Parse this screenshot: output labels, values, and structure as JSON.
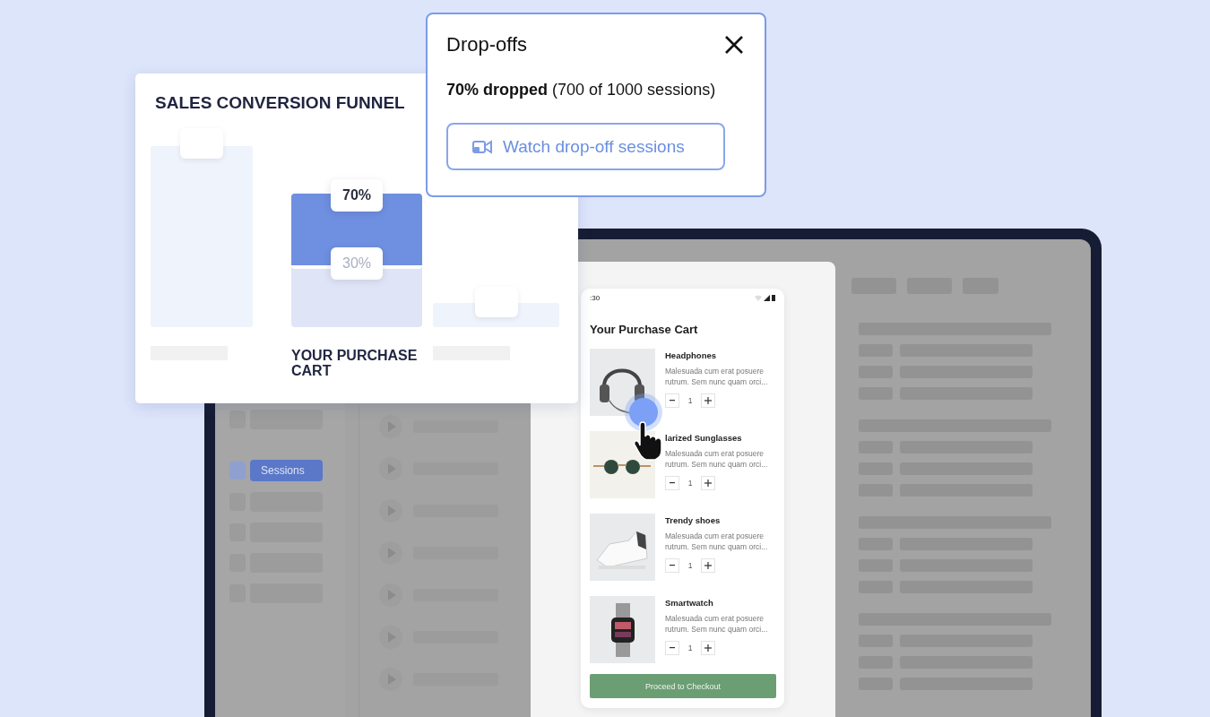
{
  "funnel": {
    "title": "SALES CONVERSION FUNNEL",
    "steps": [
      {
        "kind": "plain"
      },
      {
        "kind": "split",
        "top_badge": "70%",
        "bottom_badge": "30%",
        "label": "YOUR PURCHASE CART"
      },
      {
        "kind": "plain"
      }
    ]
  },
  "popup": {
    "title": "Drop-offs",
    "summary": "**70% dropped** (700 of 1000 sessions)",
    "button": "Watch drop-off sessions"
  },
  "sidebar": {
    "items": [
      {
        "label": "Sessions",
        "selected": true
      }
    ]
  },
  "phone": {
    "status_time": ":30",
    "title": "Your Purchase Cart",
    "products": [
      {
        "name": "Headphones",
        "description": "Malesuada cum erat posuere rutrum. Sem nunc quam orci...",
        "quantity": "1"
      },
      {
        "name": "larized Sunglasses",
        "description": "Malesuada cum erat posuere rutrum. Sem nunc quam orci...",
        "quantity": "1"
      },
      {
        "name": "Trendy shoes",
        "description": "Malesuada cum erat posuere rutrum. Sem nunc quam orci...",
        "quantity": "1"
      },
      {
        "name": "Smartwatch",
        "description": "Malesuada cum erat posuere rutrum. Sem nunc quam orci...",
        "quantity": "1"
      }
    ],
    "checkout": "Proceed to Checkout"
  }
}
